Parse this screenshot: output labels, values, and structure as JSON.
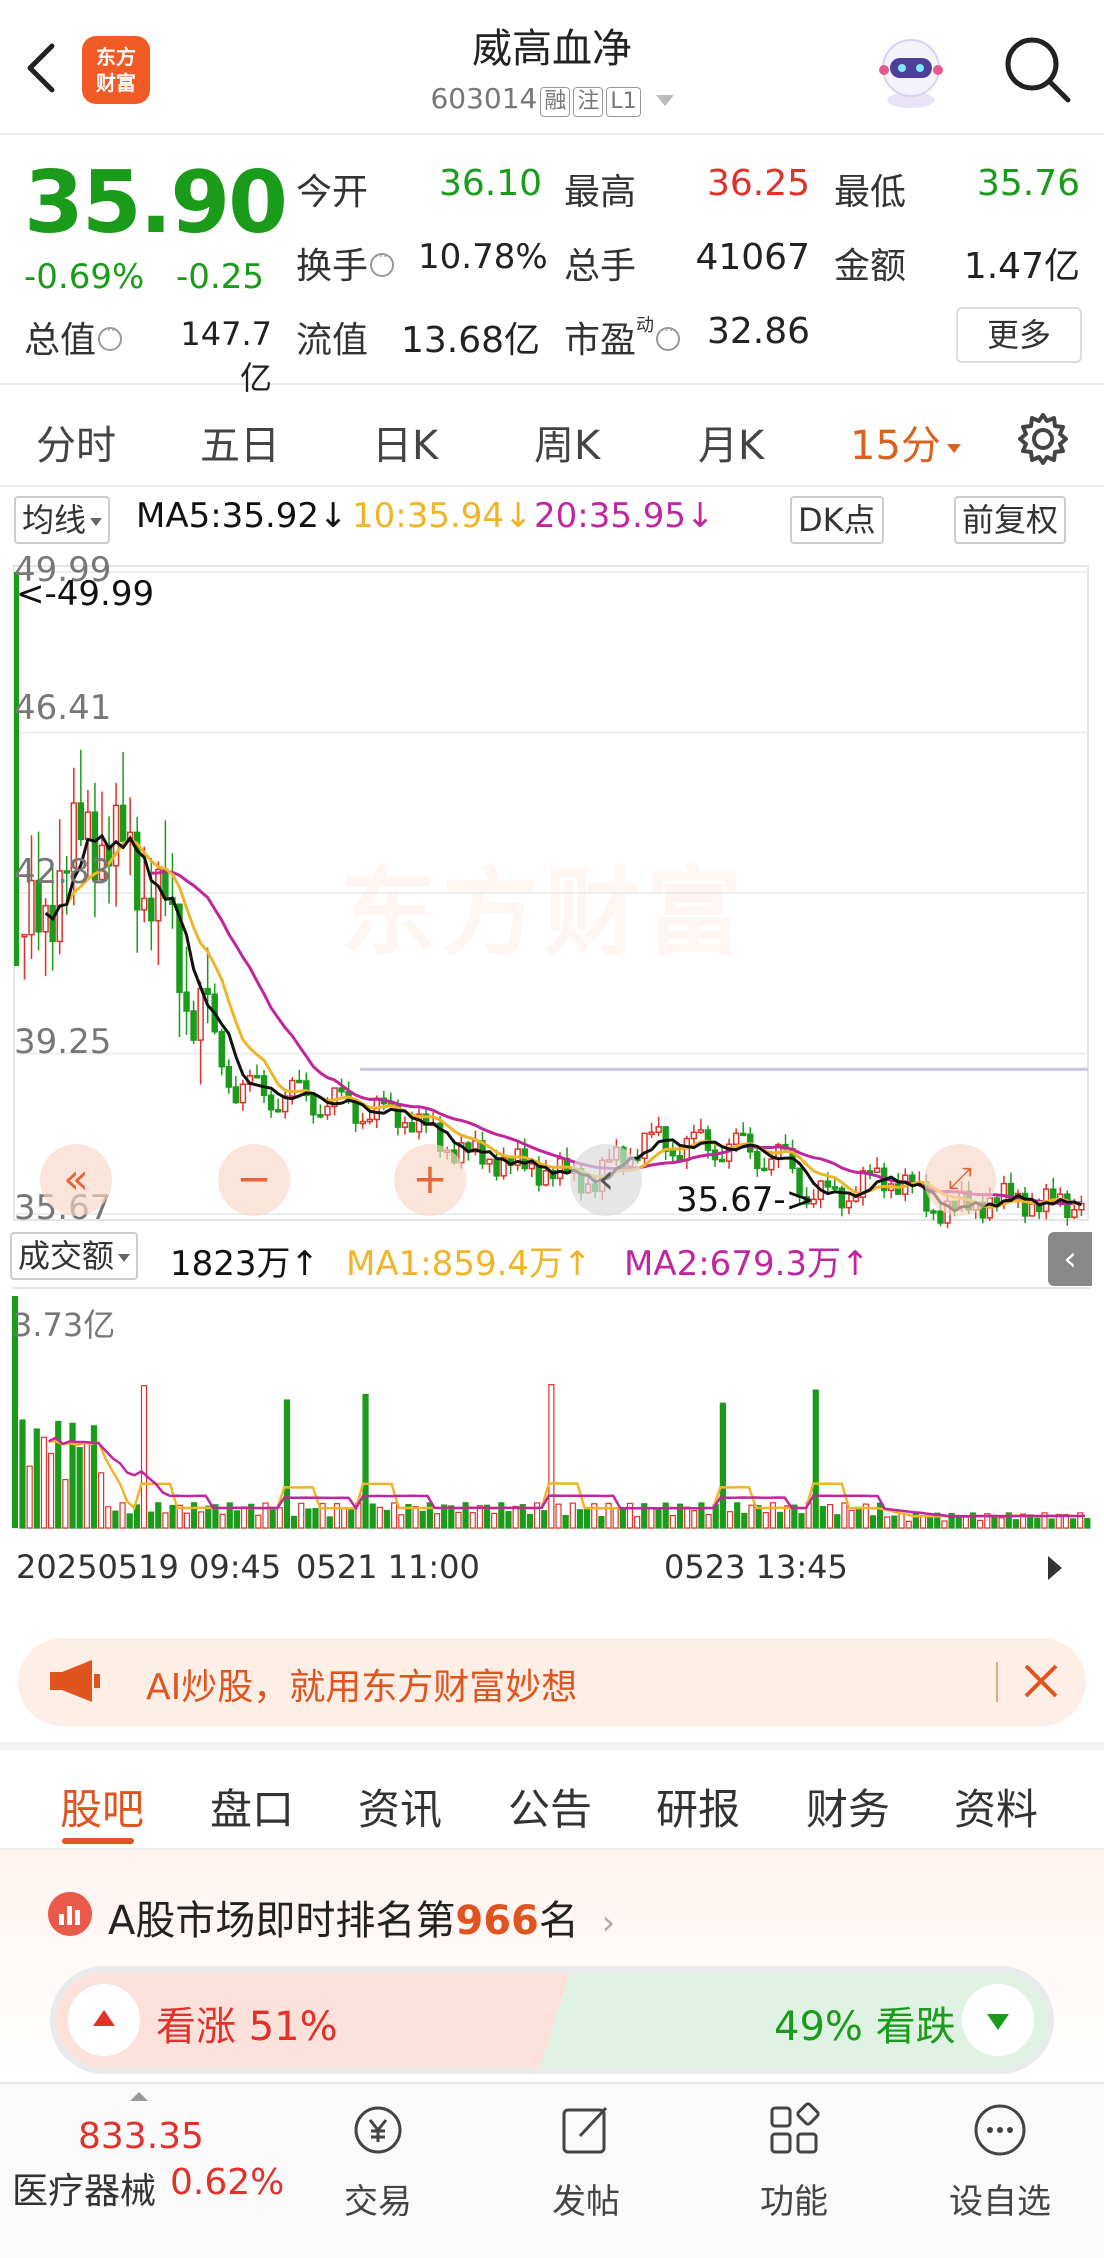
{
  "header": {
    "title": "威高血净",
    "code": "603014",
    "tags": [
      "融",
      "注",
      "L1"
    ],
    "logo_text": [
      "东方",
      "财富"
    ]
  },
  "quote": {
    "price": "35.90",
    "change_pct": "-0.69%",
    "change": "-0.25",
    "open_label": "今开",
    "open": "36.10",
    "high_label": "最高",
    "high": "36.25",
    "low_label": "最低",
    "low": "35.76",
    "turnover_label": "换手",
    "turnover": "10.78%",
    "volume_label": "总手",
    "volume": "41067",
    "amount_label": "金额",
    "amount": "1.47亿",
    "mktcap_label": "总值",
    "mktcap": "147.7亿",
    "float_label": "流值",
    "float": "13.68亿",
    "pe_label": "市盈",
    "pe_sup": "动",
    "pe": "32.86",
    "more": "更多"
  },
  "tabs": [
    "分时",
    "五日",
    "日K",
    "周K",
    "月K",
    "15分"
  ],
  "active_tab": "15分",
  "ma": {
    "toggle": "均线",
    "ma5": "MA5:35.92↓",
    "ma10": "10:35.94↓",
    "ma20": "20:35.95↓",
    "dk": "DK点",
    "fq": "前复权",
    "ma5_color": "#111111",
    "ma10_color": "#f0b429",
    "ma20_color": "#c0269e"
  },
  "chart": {
    "y_labels": [
      "49.99",
      "46.41",
      "42.83",
      "39.25",
      "35.67"
    ],
    "max_label": "<-49.99",
    "min_label": "35.67->",
    "watermark": "东方财富"
  },
  "volume": {
    "toggle": "成交额",
    "current": "1823万↑",
    "ma1": "MA1:859.4万↑",
    "ma2": "MA2:679.3万↑",
    "max_label": "3.73亿"
  },
  "time_axis": [
    "20250519 09:45",
    "0521 11:00",
    "0523 13:45"
  ],
  "banner": {
    "text": "AI炒股，就用东方财富妙想"
  },
  "content_tabs": [
    "股吧",
    "盘口",
    "资讯",
    "公告",
    "研报",
    "财务",
    "资料"
  ],
  "active_content_tab": "股吧",
  "ranking": {
    "prefix": "A股市场即时排名第",
    "number": "966",
    "suffix": "名"
  },
  "vote": {
    "up": "看涨 51%",
    "down": "49% 看跌",
    "up_fraction": 0.51
  },
  "bottom": {
    "index_value": "833.35",
    "index_name": "医疗器械",
    "index_pct": "0.62%",
    "items": [
      "交易",
      "发帖",
      "功能",
      "设自选"
    ]
  },
  "chart_data": {
    "type": "candlestick",
    "title": "",
    "period": "15分",
    "y_range": [
      35.67,
      49.99
    ],
    "y_ticks": [
      49.99,
      46.41,
      42.83,
      39.25,
      35.67
    ],
    "close_trend": [
      41.9,
      42.4,
      43.6,
      44.2,
      44.0,
      43.5,
      43.0,
      41.7,
      40.5,
      39.4,
      38.5,
      38.4,
      38.3,
      38.3,
      38.2,
      38.1,
      38.0,
      37.9,
      37.9,
      37.5,
      37.2,
      37.0,
      36.9,
      36.8,
      36.7,
      36.6,
      36.5,
      36.4,
      36.9,
      37.2,
      37.3,
      37.2,
      37.2,
      37.2,
      37.1,
      37.0,
      36.8,
      36.2,
      36.0,
      36.2,
      36.4,
      36.5,
      36.2,
      35.8,
      35.8,
      35.9,
      36.0,
      36.0,
      35.9,
      35.9,
      35.9
    ],
    "series": [
      {
        "name": "MA5",
        "current": 35.92
      },
      {
        "name": "10",
        "current": 35.94
      },
      {
        "name": "20",
        "current": 35.95
      }
    ]
  }
}
